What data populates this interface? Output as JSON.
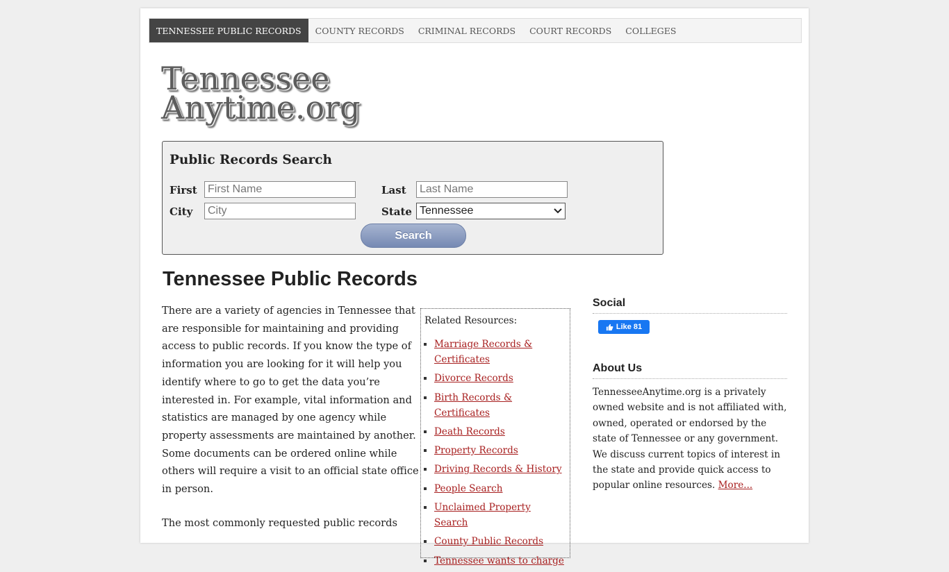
{
  "nav": {
    "items": [
      {
        "label": "TENNESSEE PUBLIC RECORDS",
        "active": true
      },
      {
        "label": "COUNTY RECORDS",
        "active": false
      },
      {
        "label": "CRIMINAL RECORDS",
        "active": false
      },
      {
        "label": "COURT RECORDS",
        "active": false
      },
      {
        "label": "COLLEGES",
        "active": false
      }
    ]
  },
  "logo": {
    "line1": "Tennessee",
    "line2": "Anytime.org"
  },
  "search": {
    "title": "Public Records Search",
    "first_label": "First",
    "first_placeholder": "First Name",
    "last_label": "Last",
    "last_placeholder": "Last Name",
    "city_label": "City",
    "city_placeholder": "City",
    "state_label": "State",
    "state_value": "Tennessee",
    "button_label": "Search"
  },
  "main": {
    "title": "Tennessee Public Records",
    "intro": "There are a variety of agencies in Tennessee that are responsible for maintaining and providing access to public records. If you know the type of information you are looking for it will help you identify where to go to get the data you’re interested in. For example, vital information and statistics are managed by one agency while property assessments are maintained by another. Some documents can be ordered online while others will require a visit to an official state office in person.",
    "intro2": "The most commonly requested public records"
  },
  "related": {
    "title": "Related Resources:",
    "items": [
      "Marriage Records & Certificates",
      "Divorce Records",
      "Birth Records & Certificates",
      "Death Records",
      "Property Records",
      "Driving Records & History",
      "People Search",
      "Unclaimed Property Search",
      "County Public Records",
      "Tennessee wants to charge"
    ]
  },
  "sidebar": {
    "social_heading": "Social",
    "like_label": "Like 81",
    "about_heading": "About Us",
    "about_text": "TennesseeAnytime.org is a privately owned website and is not affiliated with, owned, operated or endorsed by the state of Tennessee or any government. We discuss current topics of interest in the state and provide quick access to popular online resources.",
    "more_link": "More..."
  },
  "colors": {
    "nav_active_bg": "#444444",
    "link": "#a82020",
    "facebook": "#1877f2",
    "search_button": "#7689b3"
  }
}
